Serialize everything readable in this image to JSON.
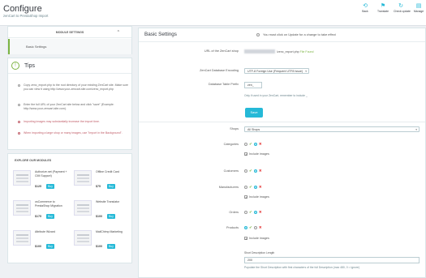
{
  "header": {
    "title": "Configure",
    "subtitle": "zenCart to PrestaShop Import",
    "toolbar": [
      {
        "label": "Back",
        "icon": "back-icon"
      },
      {
        "label": "Translate",
        "icon": "flag-icon"
      },
      {
        "label": "Check update",
        "icon": "refresh-icon"
      },
      {
        "label": "Manage",
        "icon": "book-icon"
      }
    ]
  },
  "sidebar": {
    "modules_heading": "MODULE SETTINGS",
    "modules_item": "Basic Settings",
    "tips": {
      "title": "Tips",
      "items": [
        "Copy zenc_export.php to the root directory of your existing ZenCart site. Make sure you can view it using http://www.your-zencart-site.com/zenc_export.php",
        "Enter the full URL of your ZenCart site below and click \"save\" (Example: http://www.your-zencart-site.com).",
        "Importing images may substantially increase the import time.",
        "When importing a large shop or many images, use \"Import in the Background\"."
      ]
    },
    "explore": {
      "title": "EXPLORE OUR MODULES",
      "buy_label": "Buy",
      "modules": [
        {
          "name": "Authorize.net (Payment + CIM Support)",
          "price": "$125"
        },
        {
          "name": "Offline Credit Card",
          "price": "$75"
        },
        {
          "name": "osCommerce to PrestaShop Migration",
          "price": "$175"
        },
        {
          "name": "Website Translator",
          "price": "$100"
        },
        {
          "name": "Attribute Wizard",
          "price": "$100"
        },
        {
          "name": "MailChimp Marketing",
          "price": "$100"
        }
      ]
    }
  },
  "main": {
    "title": "Basic Settings",
    "notice": "You must click on Update for a change to take effect",
    "url_label": "URL of the ZenCart shop",
    "url_file": "/zenc_export.php",
    "url_status": "File Found",
    "encoding_label": "ZenCart Database Encoding",
    "encoding_value": "UTF-8 Foreign Use (Frequent UTF8 Issue)",
    "prefix_label": "Database Table Prefix",
    "prefix_value": "zen_",
    "prefix_help": "Only if used in your ZenCart, remember to include _",
    "save_label": "Save",
    "shops_label": "Shops",
    "shops_value": "All Shops",
    "include_images_label": "Include images",
    "sections": {
      "categories": "Categories",
      "customers": "Customers",
      "manufacturers": "Manufacturers",
      "orders": "Orders",
      "products": "Products"
    },
    "short_desc_label": "Short Description Length",
    "short_desc_value": "200",
    "short_desc_help": "Populate the Short Description with first characters of the full Description (max 480, 0 = ignore)"
  },
  "colors": {
    "accent": "#25b9d7",
    "success": "#7cb342",
    "danger": "#e84e4e"
  }
}
